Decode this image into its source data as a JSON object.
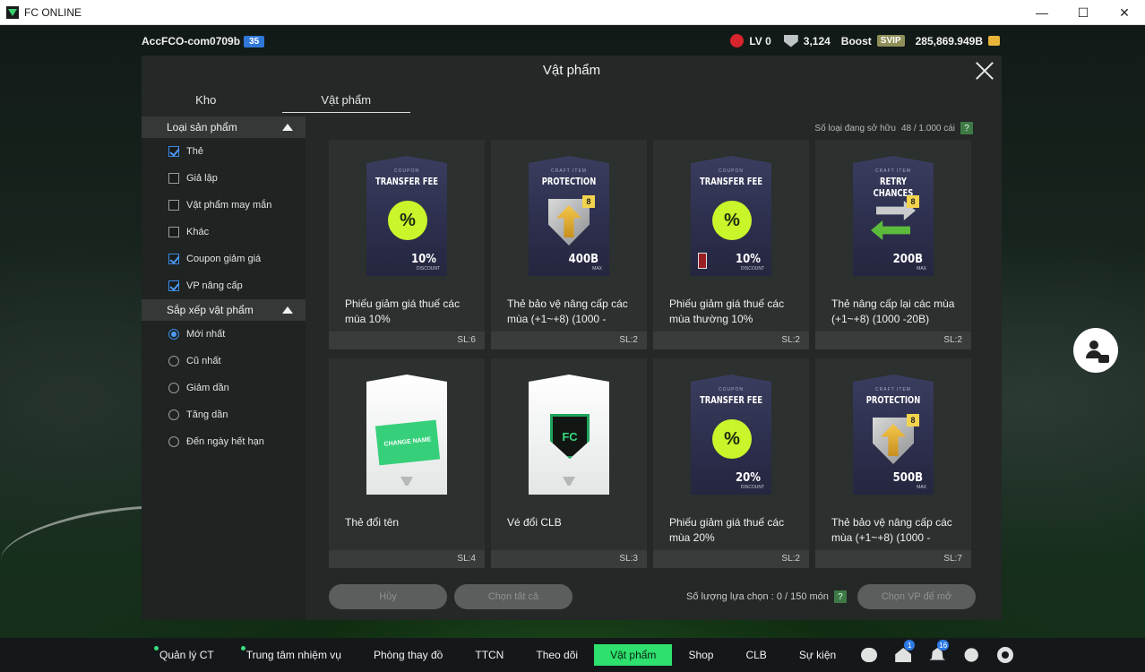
{
  "window": {
    "title": "FC ONLINE",
    "minimize_glyph": "—",
    "maximize_glyph": "☐",
    "close_glyph": "✕"
  },
  "topbar": {
    "account": "AccFCO-com0709b",
    "account_level": "35",
    "lv": "LV 0",
    "points": "3,124",
    "boost": "Boost",
    "svip": "SVIP",
    "bp": "285,869.949B"
  },
  "modal": {
    "title": "Vật phẩm",
    "tabs": [
      "Kho",
      "Vật phẩm"
    ],
    "owned_label": "Số loại đang sở hữu",
    "owned_value": "48 / 1.000 cái",
    "help": "?"
  },
  "sidebar": {
    "product_type_title": "Loại sản phẩm",
    "product_types": [
      {
        "label": "Thẻ",
        "checked": true
      },
      {
        "label": "Giả lập",
        "checked": false
      },
      {
        "label": "Vật phẩm may mắn",
        "checked": false
      },
      {
        "label": "Khác",
        "checked": false
      },
      {
        "label": "Coupon giảm giá",
        "checked": true
      },
      {
        "label": "VP nâng cấp",
        "checked": true
      }
    ],
    "sort_title": "Sắp xếp vật phẩm",
    "sort_options": [
      {
        "label": "Mới nhất",
        "selected": true
      },
      {
        "label": "Cũ nhất",
        "selected": false
      },
      {
        "label": "Giảm dần",
        "selected": false
      },
      {
        "label": "Tăng dần",
        "selected": false
      },
      {
        "label": "Đến ngày hết hạn",
        "selected": false
      }
    ]
  },
  "items": [
    {
      "card_style": "dark",
      "art": "coupon",
      "card_tag": "COUPON",
      "card_title": "TRANSFER FEE",
      "card_value": "10%",
      "card_sub": "DISCOUNT",
      "name": "Phiếu giảm giá thuế các mùa 10%",
      "qty": "SL:6"
    },
    {
      "card_style": "dark",
      "art": "protection",
      "card_tag": "CRAFT ITEM",
      "card_title": "PROTECTION",
      "card_value": "400B",
      "card_sub": "MAX",
      "tag": "8",
      "name": "Thẻ bảo vệ nâng cấp các mùa (+1~+8) (1000 -",
      "qty": "SL:2"
    },
    {
      "card_style": "dark",
      "art": "coupon-lock",
      "card_tag": "COUPON",
      "card_title": "TRANSFER FEE",
      "card_value": "10%",
      "card_sub": "DISCOUNT",
      "name": "Phiếu giảm giá thuế các mùa thường 10%",
      "qty": "SL:2"
    },
    {
      "card_style": "dark",
      "art": "retry",
      "card_tag": "CRAFT ITEM",
      "card_title": "RETRY CHANCES",
      "card_value": "200B",
      "card_sub": "MAX",
      "tag": "8",
      "name": "Thẻ nâng cấp lại các mùa (+1~+8) (1000 -20B)",
      "qty": "SL:2"
    },
    {
      "card_style": "white",
      "art": "change-name",
      "card_label": "CHANGE NAME",
      "name": "Thẻ đổi tên",
      "qty": "SL:4"
    },
    {
      "card_style": "white",
      "art": "club",
      "card_label": "FC",
      "name": "Vé đổi CLB",
      "qty": "SL:3"
    },
    {
      "card_style": "dark",
      "art": "coupon",
      "card_tag": "COUPON",
      "card_title": "TRANSFER FEE",
      "card_value": "20%",
      "card_sub": "DISCOUNT",
      "name": "Phiếu giảm giá thuế các mùa 20%",
      "qty": "SL:2"
    },
    {
      "card_style": "dark",
      "art": "protection",
      "card_tag": "CRAFT ITEM",
      "card_title": "PROTECTION",
      "card_value": "500B",
      "card_sub": "MAX",
      "tag": "8",
      "name": "Thẻ bảo vệ nâng cấp các mùa (+1~+8) (1000 -",
      "qty": "SL:7"
    }
  ],
  "actions": {
    "cancel": "Hủy",
    "select_all": "Chọn tất cả",
    "selected_label": "Số lượng lựa chọn : 0 / 150 món",
    "open": "Chọn VP để mở"
  },
  "bottom_nav": [
    {
      "label": "Quản lý CT",
      "dot": true
    },
    {
      "label": "Trung tâm nhiệm vụ",
      "dot": true
    },
    {
      "label": "Phòng thay đồ",
      "dot": false
    },
    {
      "label": "TTCN",
      "dot": false
    },
    {
      "label": "Theo dõi",
      "dot": false
    },
    {
      "label": "Vật phẩm",
      "dot": false,
      "active": true
    },
    {
      "label": "Shop",
      "dot": false
    },
    {
      "label": "CLB",
      "dot": false
    },
    {
      "label": "Sự kiện",
      "dot": false
    }
  ],
  "nav_badges": {
    "home": "1",
    "bell": "16"
  },
  "colors": {
    "accent_green": "#2ee06d",
    "check_blue": "#4e9cf3",
    "coupon_lime": "#c9f52b"
  }
}
